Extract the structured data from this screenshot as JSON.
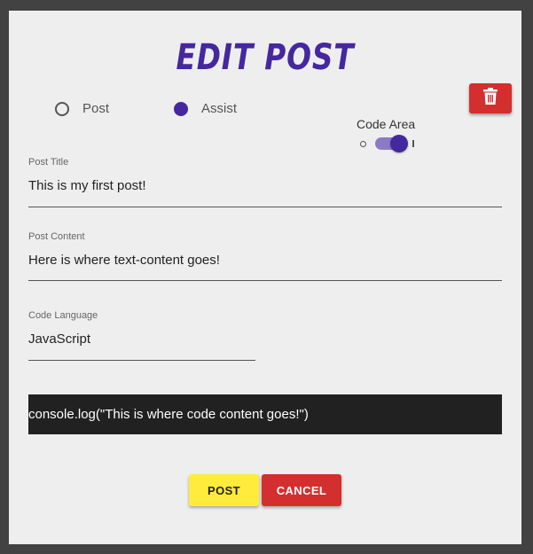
{
  "dialog": {
    "title": "EDIT POST",
    "colors": {
      "accent": "#4527a0",
      "delete": "#d32f2f",
      "post": "#ffeb3b",
      "code_bg": "#212121"
    }
  },
  "post_type": {
    "options": [
      {
        "label": "Post",
        "selected": false
      },
      {
        "label": "Assist",
        "selected": true
      }
    ]
  },
  "code_area": {
    "label": "Code Area",
    "enabled": true
  },
  "fields": {
    "title": {
      "label": "Post Title",
      "value": "This is my first post!"
    },
    "content": {
      "label": "Post Content",
      "value": "Here is where text-content goes!"
    },
    "language": {
      "label": "Code Language",
      "value": "JavaScript"
    }
  },
  "code": {
    "value": "console.log(\"This is where code content goes!\")"
  },
  "actions": {
    "post_label": "POST",
    "cancel_label": "CANCEL",
    "delete_icon": "trash-icon"
  }
}
